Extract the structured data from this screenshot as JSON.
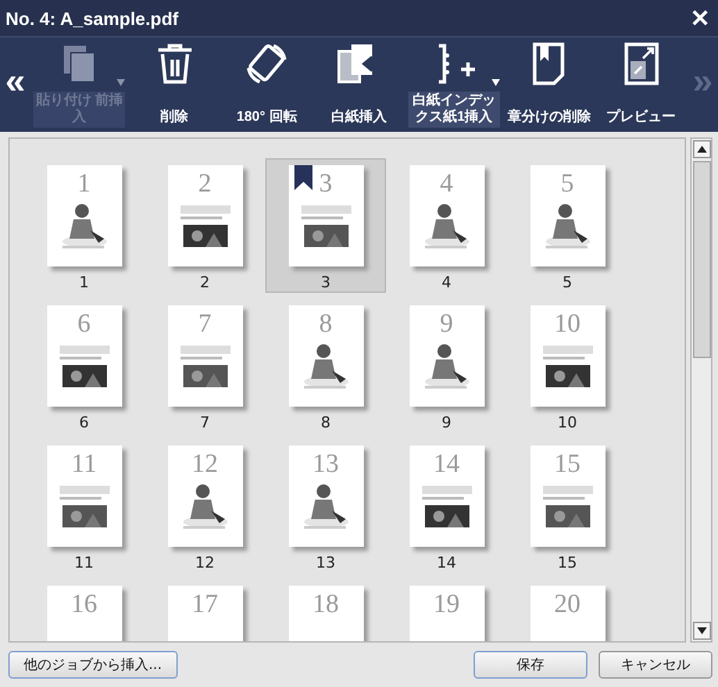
{
  "window": {
    "title": "No. 4: A_sample.pdf",
    "close": "✕"
  },
  "toolbar": {
    "prev": {
      "glyph": "«",
      "disabled": false
    },
    "next": {
      "glyph": "»",
      "disabled": true
    },
    "items": [
      {
        "kind": "paste",
        "label": "貼り付け 前挿入",
        "disabled": true,
        "dropdown": true,
        "highlighted": false
      },
      {
        "kind": "delete",
        "label": "削除",
        "disabled": false,
        "dropdown": false,
        "highlighted": false
      },
      {
        "kind": "rotate",
        "label": "180° 回転",
        "disabled": false,
        "dropdown": false,
        "highlighted": false
      },
      {
        "kind": "blank",
        "label": "白紙挿入",
        "disabled": false,
        "dropdown": false,
        "highlighted": false
      },
      {
        "kind": "index",
        "label": "白紙インデックス紙1挿入",
        "disabled": false,
        "dropdown": true,
        "highlighted": true
      },
      {
        "kind": "chapter",
        "label": "章分けの削除",
        "disabled": false,
        "dropdown": false,
        "highlighted": false
      },
      {
        "kind": "preview",
        "label": "プレビュー",
        "disabled": false,
        "dropdown": false,
        "highlighted": false
      }
    ]
  },
  "pages": [
    {
      "numeral": "1",
      "label": "1",
      "selected": false,
      "bookmarked": false
    },
    {
      "numeral": "2",
      "label": "2",
      "selected": false,
      "bookmarked": false
    },
    {
      "numeral": "3",
      "label": "3",
      "selected": true,
      "bookmarked": true
    },
    {
      "numeral": "4",
      "label": "4",
      "selected": false,
      "bookmarked": false
    },
    {
      "numeral": "5",
      "label": "5",
      "selected": false,
      "bookmarked": false
    },
    {
      "numeral": "6",
      "label": "6",
      "selected": false,
      "bookmarked": false
    },
    {
      "numeral": "7",
      "label": "7",
      "selected": false,
      "bookmarked": false
    },
    {
      "numeral": "8",
      "label": "8",
      "selected": false,
      "bookmarked": false
    },
    {
      "numeral": "9",
      "label": "9",
      "selected": false,
      "bookmarked": false
    },
    {
      "numeral": "10",
      "label": "10",
      "selected": false,
      "bookmarked": false
    },
    {
      "numeral": "11",
      "label": "11",
      "selected": false,
      "bookmarked": false
    },
    {
      "numeral": "12",
      "label": "12",
      "selected": false,
      "bookmarked": false
    },
    {
      "numeral": "13",
      "label": "13",
      "selected": false,
      "bookmarked": false
    },
    {
      "numeral": "14",
      "label": "14",
      "selected": false,
      "bookmarked": false
    },
    {
      "numeral": "15",
      "label": "15",
      "selected": false,
      "bookmarked": false
    },
    {
      "numeral": "16",
      "selected": false,
      "bookmarked": false
    },
    {
      "numeral": "17",
      "selected": false,
      "bookmarked": false
    },
    {
      "numeral": "18",
      "selected": false,
      "bookmarked": false
    },
    {
      "numeral": "19",
      "selected": false,
      "bookmarked": false
    },
    {
      "numeral": "20",
      "selected": false,
      "bookmarked": false
    }
  ],
  "footer": {
    "insert_button": "他のジョブから挿入...",
    "save_button": "保存",
    "cancel_button": "キャンセル"
  }
}
